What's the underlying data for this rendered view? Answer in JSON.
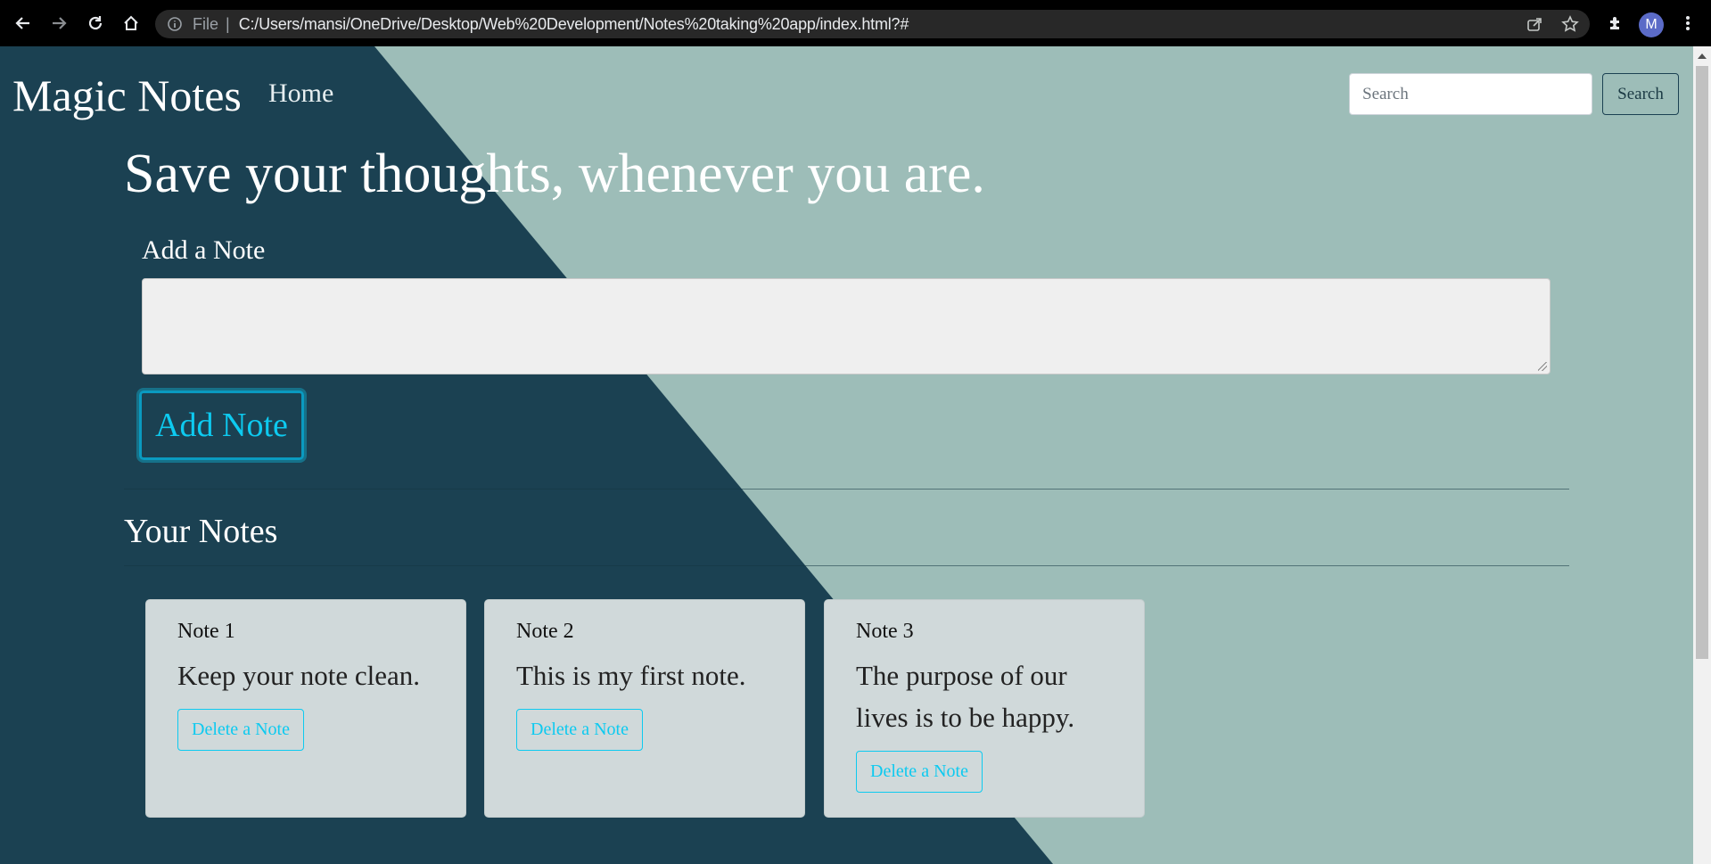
{
  "browser": {
    "url_scheme_label": "File",
    "url": "C:/Users/mansi/OneDrive/Desktop/Web%20Development/Notes%20taking%20app/index.html?#",
    "profile_initial": "M"
  },
  "navbar": {
    "brand": "Magic Notes",
    "home_label": "Home",
    "search_placeholder": "Search",
    "search_button": "Search"
  },
  "hero": {
    "title": "Save your thoughts, whenever you are."
  },
  "add_note": {
    "label": "Add a Note",
    "textarea_value": "",
    "button_label": "Add Note"
  },
  "notes_section": {
    "heading": "Your Notes",
    "notes": [
      {
        "title": "Note 1",
        "text": "Keep your note clean.",
        "delete_label": "Delete a Note"
      },
      {
        "title": "Note 2",
        "text": "This is my first note.",
        "delete_label": "Delete a Note"
      },
      {
        "title": "Note 3",
        "text": "The purpose of our lives is to be happy.",
        "delete_label": "Delete a Note"
      }
    ]
  },
  "colors": {
    "dark_panel": "#1b4152",
    "light_panel": "#9dbdb8",
    "accent": "#0dcaf0",
    "card": "#d0d9da"
  }
}
